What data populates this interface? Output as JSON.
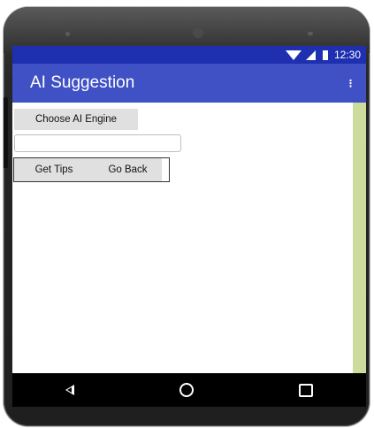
{
  "status_bar": {
    "time": "12:30"
  },
  "app_bar": {
    "title": "AI Suggestion",
    "overflow_icon": "⋮"
  },
  "content": {
    "choose_button": "Choose AI Engine",
    "text_input": {
      "value": "",
      "placeholder": ""
    },
    "get_tips_button": "Get Tips",
    "go_back_button": "Go Back"
  },
  "colors": {
    "status_bar": "#1e2fb0",
    "app_bar": "#3f51c4",
    "right_strip": "#cddc9c",
    "button_bg": "#e0e0e0"
  },
  "icons": [
    "wifi-icon",
    "signal-icon",
    "battery-icon",
    "overflow-menu-icon",
    "nav-back-icon",
    "nav-home-icon",
    "nav-recents-icon"
  ]
}
